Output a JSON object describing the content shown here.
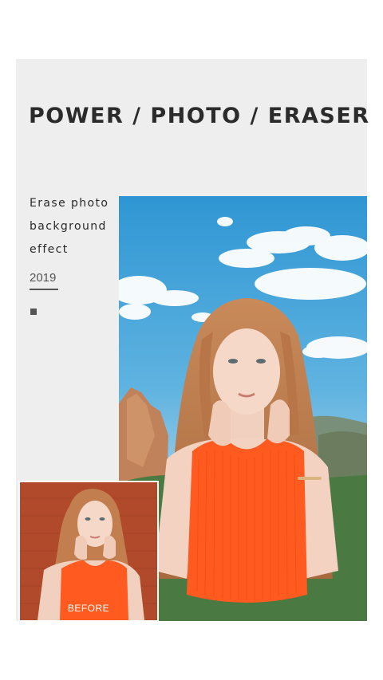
{
  "header": {
    "title": "POWER / PHOTO / ERASER"
  },
  "description": {
    "line1": "Erase photo",
    "line2": "background",
    "line3": "effect"
  },
  "year": "2019",
  "before_label": "BEFORE",
  "colors": {
    "card_bg": "#eeeeef",
    "sky": "#3aa0d6",
    "top_orange": "#ff5a1f",
    "brick": "#b84a2a"
  }
}
